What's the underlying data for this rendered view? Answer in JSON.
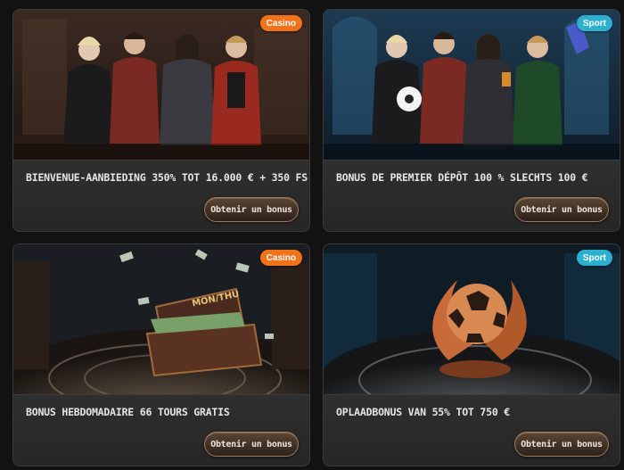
{
  "colors": {
    "page_bg": "#121212",
    "card_bg": "#2a2a2a",
    "casino_badge": "#f0731a",
    "sport_badge": "#2bb0d0",
    "button_border": "#a07a58"
  },
  "cards": [
    {
      "badge": "Casino",
      "badge_color": "#f0731a",
      "title": "Bienvenue-aanbieding 350% tot 16.000 € + 350 FS",
      "button": "Obtenir un bonus",
      "image": "casino-characters-illustration"
    },
    {
      "badge": "Sport",
      "badge_color": "#2bb0d0",
      "title": "Bonus de premier dépôt 100 % slechts 100 €",
      "button": "Obtenir un bonus",
      "image": "sport-characters-illustration"
    },
    {
      "badge": "Casino",
      "badge_color": "#f0731a",
      "title": "Bonus hebdomadaire 66 tours gratis",
      "button": "Obtenir un bonus",
      "image": "money-chest-illustration",
      "chest_label": "MON/THU"
    },
    {
      "badge": "Sport",
      "badge_color": "#2bb0d0",
      "title": "Oplaadbonus van 55% tot 750 €",
      "button": "Obtenir un bonus",
      "image": "football-trophy-illustration"
    }
  ]
}
